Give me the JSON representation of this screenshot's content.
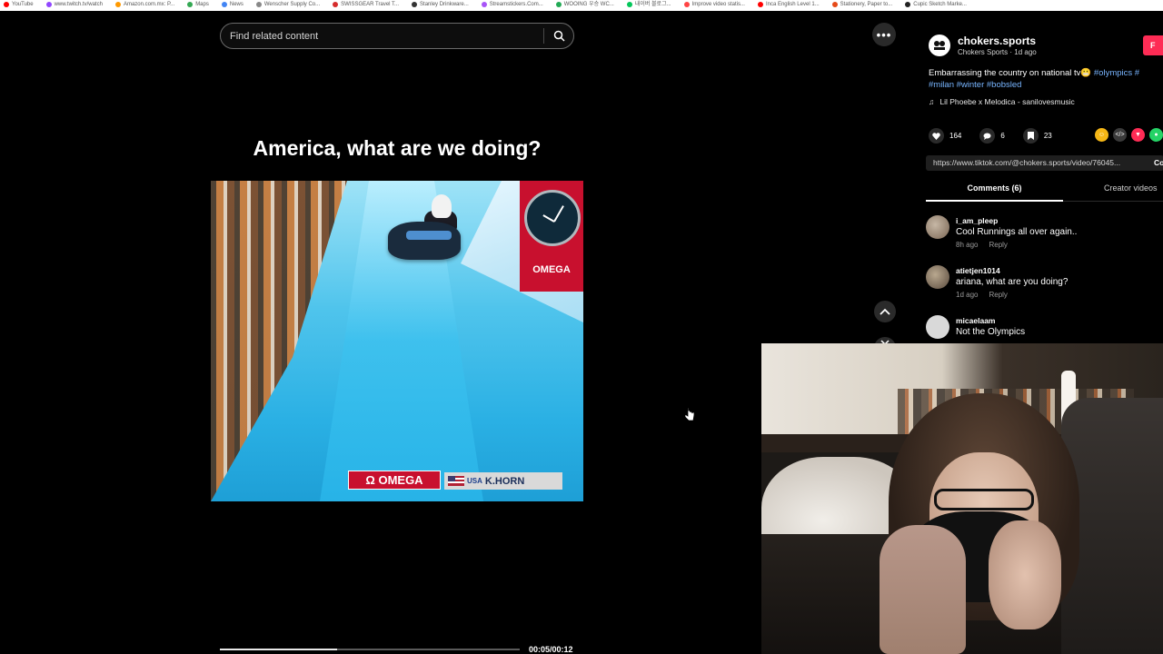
{
  "bookmarks": [
    {
      "label": "YouTube",
      "color": "#ff0000"
    },
    {
      "label": "www.twitch.tv/watch",
      "color": "#9146ff"
    },
    {
      "label": "Amazon.com.mx: P...",
      "color": "#ff9900"
    },
    {
      "label": "Maps",
      "color": "#34a853"
    },
    {
      "label": "News",
      "color": "#4285f4"
    },
    {
      "label": "Wenscher Supply Co...",
      "color": "#888888"
    },
    {
      "label": "SWISSGEAR Travel T...",
      "color": "#d62d2d"
    },
    {
      "label": "Stanley Drinkware...",
      "color": "#333333"
    },
    {
      "label": "Streamstickers.Com...",
      "color": "#a855f7"
    },
    {
      "label": "WOOING 우승 WC...",
      "color": "#22aa55"
    },
    {
      "label": "내이버 블로그...",
      "color": "#03c75a"
    },
    {
      "label": "Improve video statis...",
      "color": "#ff4444"
    },
    {
      "label": "Inca English Level 1...",
      "color": "#ff0000"
    },
    {
      "label": "Stationery, Paper to...",
      "color": "#e64a19"
    },
    {
      "label": "Cupic Sketch Marke...",
      "color": "#222222"
    }
  ],
  "search": {
    "placeholder": "Find related content"
  },
  "video": {
    "caption": "America, what are we doing?",
    "overlay_brand": "OMEGA",
    "banner_brand": "Ω OMEGA",
    "banner_country": "USA",
    "banner_athlete": "K.HORN",
    "time": "00:05/00:12",
    "progress": 0.39
  },
  "post": {
    "author": "chokers.sports",
    "author_sub": "Chokers Sports · 1d ago",
    "follow_label": "F",
    "description": "Embarrassing the country on national tv",
    "tags_line1": "#olympics #",
    "tags_line2": "#milan #winter #bobsled",
    "music": "Lil Phoebe x Melodica - sanilovesmusic",
    "likes": "164",
    "comments_count": "6",
    "saves": "23",
    "link": "https://www.tiktok.com/@chokers.sports/video/76045...",
    "link_cta": "Co",
    "tabs": {
      "comments": "Comments (6)",
      "creator": "Creator videos"
    }
  },
  "comments": [
    {
      "user": "i_am_pleep",
      "text": "Cool Runnings all over again..",
      "time": "8h ago",
      "reply": "Reply",
      "avatar_color": "#8a7766"
    },
    {
      "user": "atietjen1014",
      "text": "ariana, what are you doing?",
      "time": "1d ago",
      "reply": "Reply",
      "avatar_color": "#6e6255"
    },
    {
      "user": "micaelaam",
      "text": "Not the Olympics",
      "time": "",
      "reply": "",
      "avatar_color": "#d9d9d9"
    }
  ],
  "colors": {
    "accent": "#fe2c55",
    "tag": "#78b5ff",
    "share_gold": "#f6b716",
    "share_red": "#fe2c55",
    "share_green": "#25d366",
    "share_gray": "#3a3a3a"
  }
}
